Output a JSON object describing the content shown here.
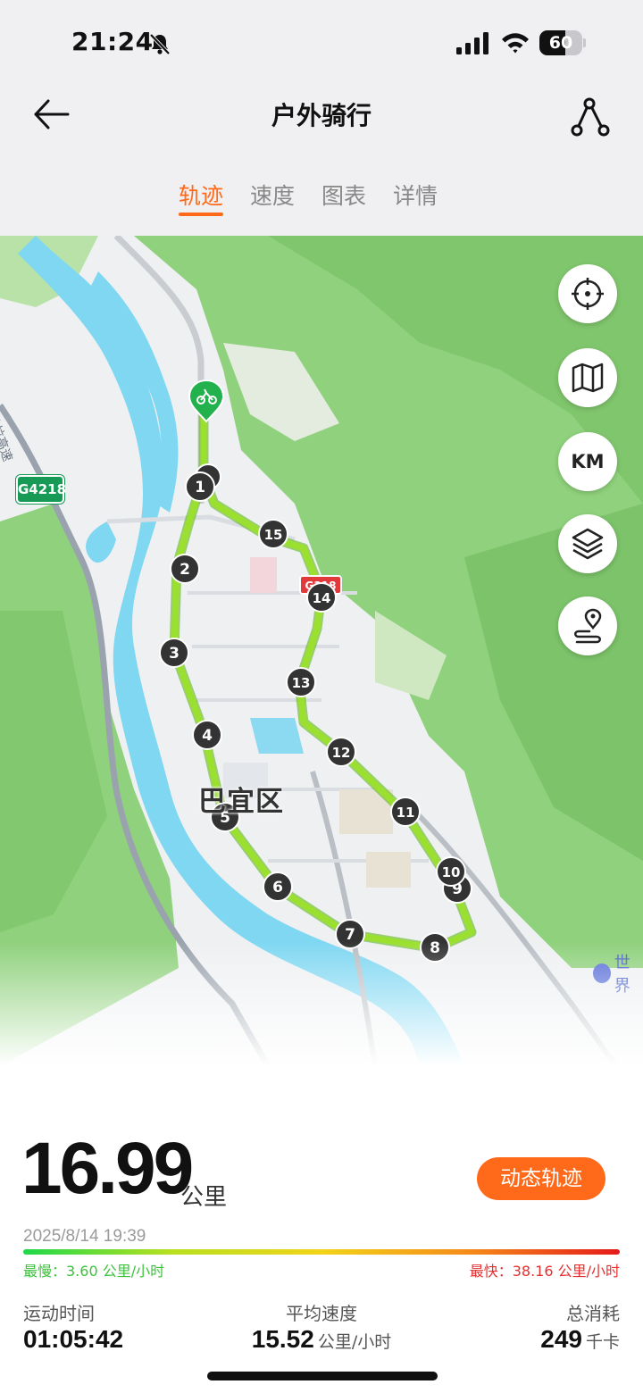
{
  "status_bar": {
    "time": "21:24",
    "battery": "60",
    "battery_level": 0.6
  },
  "header": {
    "title": "户外骑行"
  },
  "tabs": [
    {
      "label": "轨迹",
      "active": true
    },
    {
      "label": "速度",
      "active": false
    },
    {
      "label": "图表",
      "active": false
    },
    {
      "label": "详情",
      "active": false
    }
  ],
  "map": {
    "district_label": "巴宜区",
    "highway_badge": "G4218",
    "road_label": "林拉高速",
    "poi_label": "世界",
    "route_marker_label": "G318",
    "km_label": "KM",
    "markers": [
      "1",
      "2",
      "3",
      "4",
      "5",
      "6",
      "7",
      "8",
      "9",
      "10",
      "11",
      "12",
      "13",
      "14",
      "15"
    ],
    "controls": [
      "locate-icon",
      "map-icon",
      "km-toggle",
      "layers-icon",
      "route-pin-icon"
    ],
    "colors": {
      "route": "#8ee02a",
      "water": "#7fd7f2",
      "green": "#8fd17c",
      "land": "#eef0f2",
      "road": "#c9cdd2"
    }
  },
  "stats": {
    "distance": "16.99",
    "distance_unit": "公里",
    "replay_label": "动态轨迹",
    "datetime": "2025/8/14 19:39",
    "slowest": "最慢：3.60 公里/小时",
    "fastest": "最快：38.16 公里/小时",
    "duration_label": "运动时间",
    "duration": "01:05:42",
    "avg_speed_label": "平均速度",
    "avg_speed": "15.52",
    "avg_speed_unit": "公里/小时",
    "calories_label": "总消耗",
    "calories": "249",
    "calories_unit": "千卡"
  },
  "accent_color": "#ff6a1a"
}
